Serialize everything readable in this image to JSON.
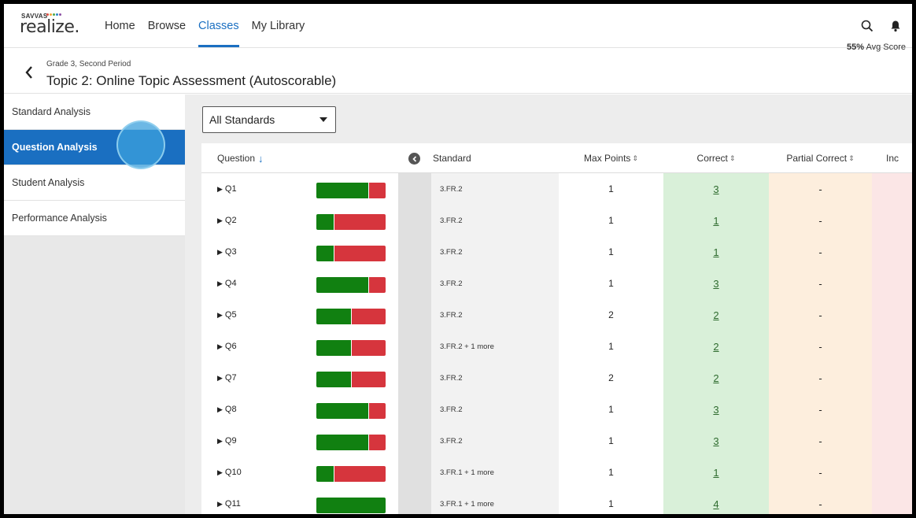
{
  "nav": {
    "brand_small": "SAVVAS",
    "brand": "realize.",
    "links": [
      {
        "label": "Home",
        "active": false
      },
      {
        "label": "Browse",
        "active": false
      },
      {
        "label": "Classes",
        "active": true
      },
      {
        "label": "My Library",
        "active": false
      }
    ],
    "icons": [
      "search-icon",
      "bell-icon"
    ]
  },
  "header": {
    "subtitle": "Grade 3, Second Period",
    "title": "Topic 2: Online Topic Assessment (Autoscorable)",
    "avg_score_value": "55%",
    "avg_score_label": "Avg Score"
  },
  "sidebar": {
    "items": [
      {
        "label": "Standard Analysis",
        "active": false
      },
      {
        "label": "Question Analysis",
        "active": true
      },
      {
        "label": "Student Analysis",
        "active": false
      },
      {
        "label": "Performance Analysis",
        "active": false
      }
    ]
  },
  "filter": {
    "selected": "All Standards"
  },
  "table": {
    "columns": {
      "question": "Question",
      "standard": "Standard",
      "max_points": "Max Points",
      "correct": "Correct",
      "partial_correct": "Partial Correct",
      "incorrect": "Inc"
    },
    "rows": [
      {
        "q": "Q1",
        "correct_pct": 0.75,
        "standard": "3.FR.2",
        "max": "1",
        "correct": "3",
        "partial": "-"
      },
      {
        "q": "Q2",
        "correct_pct": 0.25,
        "standard": "3.FR.2",
        "max": "1",
        "correct": "1",
        "partial": "-"
      },
      {
        "q": "Q3",
        "correct_pct": 0.25,
        "standard": "3.FR.2",
        "max": "1",
        "correct": "1",
        "partial": "-"
      },
      {
        "q": "Q4",
        "correct_pct": 0.75,
        "standard": "3.FR.2",
        "max": "1",
        "correct": "3",
        "partial": "-"
      },
      {
        "q": "Q5",
        "correct_pct": 0.5,
        "standard": "3.FR.2",
        "max": "2",
        "correct": "2",
        "partial": "-"
      },
      {
        "q": "Q6",
        "correct_pct": 0.5,
        "standard": "3.FR.2 + 1 more",
        "max": "1",
        "correct": "2",
        "partial": "-"
      },
      {
        "q": "Q7",
        "correct_pct": 0.5,
        "standard": "3.FR.2",
        "max": "2",
        "correct": "2",
        "partial": "-"
      },
      {
        "q": "Q8",
        "correct_pct": 0.75,
        "standard": "3.FR.2",
        "max": "1",
        "correct": "3",
        "partial": "-"
      },
      {
        "q": "Q9",
        "correct_pct": 0.75,
        "standard": "3.FR.2",
        "max": "1",
        "correct": "3",
        "partial": "-"
      },
      {
        "q": "Q10",
        "correct_pct": 0.25,
        "standard": "3.FR.1 + 1 more",
        "max": "1",
        "correct": "1",
        "partial": "-"
      },
      {
        "q": "Q11",
        "correct_pct": 1.0,
        "standard": "3.FR.1 + 1 more",
        "max": "1",
        "correct": "4",
        "partial": "-"
      }
    ]
  },
  "colors": {
    "accent": "#1a6fc1",
    "bar_correct": "#118011",
    "bar_incorrect": "#d6353d"
  }
}
